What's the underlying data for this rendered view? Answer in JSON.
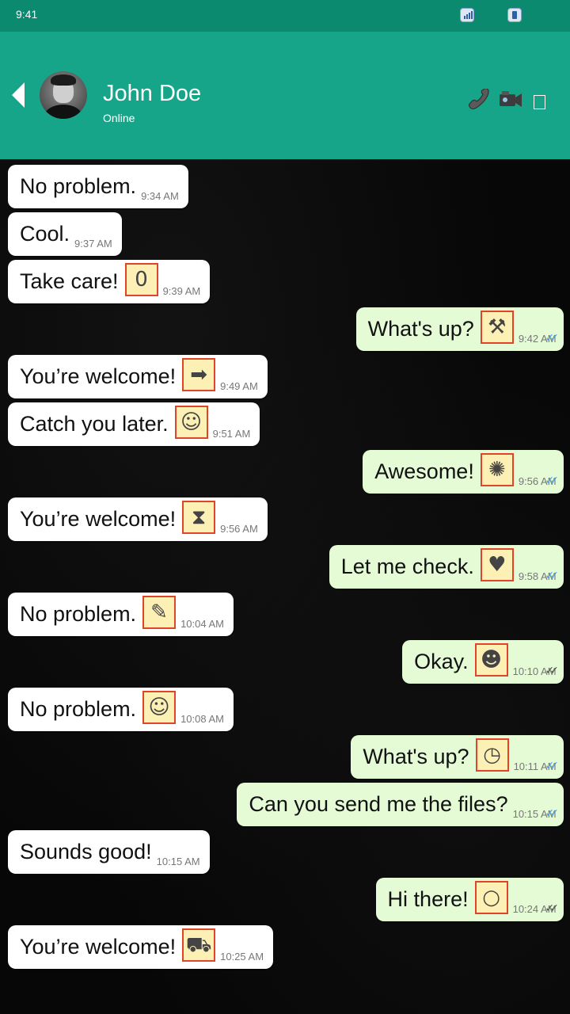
{
  "status_bar": {
    "time": "9:41"
  },
  "header": {
    "contact_name": "John Doe",
    "contact_status": "Online",
    "icons": [
      "back-arrow-icon",
      "phone-icon",
      "video-camera-icon",
      "menu-icon"
    ],
    "colors": {
      "header": "#17a58a",
      "status_bar": "#0b8a70"
    }
  },
  "messages": [
    {
      "dir": "in",
      "text": "No problem.",
      "emoji": "",
      "emoji_name": "",
      "time": "9:34 AM"
    },
    {
      "dir": "in",
      "text": "Cool.",
      "emoji": "",
      "emoji_name": "",
      "time": "9:37 AM"
    },
    {
      "dir": "in",
      "text": "Take care!",
      "emoji": "0",
      "emoji_name": "keycap-zero",
      "time": "9:39 AM"
    },
    {
      "dir": "out",
      "text": "What's up?",
      "emoji": "⚒",
      "emoji_name": "hammer-and-wrench",
      "time": "9:42 AM",
      "ticks": "read"
    },
    {
      "dir": "in",
      "text": "You’re welcome!",
      "emoji": "➡",
      "emoji_name": "person-with-cane-right",
      "time": "9:49 AM"
    },
    {
      "dir": "in",
      "text": "Catch you later.",
      "emoji": "☺",
      "emoji_name": "woman-guard",
      "time": "9:51 AM"
    },
    {
      "dir": "out",
      "text": "Awesome!",
      "emoji": "✺",
      "emoji_name": "hedgehog",
      "time": "9:56 AM",
      "ticks": "read"
    },
    {
      "dir": "in",
      "text": "You’re welcome!",
      "emoji": "⧗",
      "emoji_name": "thread-spool",
      "time": "9:56 AM"
    },
    {
      "dir": "out",
      "text": "Let me check.",
      "emoji": "♥",
      "emoji_name": "couple-with-heart",
      "time": "9:58 AM",
      "ticks": "read"
    },
    {
      "dir": "in",
      "text": "No problem.",
      "emoji": "✎",
      "emoji_name": "pen",
      "time": "10:04 AM"
    },
    {
      "dir": "out",
      "text": "Okay.",
      "emoji": "☻",
      "emoji_name": "woman-face",
      "time": "10:10 AM",
      "ticks": "sent"
    },
    {
      "dir": "in",
      "text": "No problem.",
      "emoji": "☺",
      "emoji_name": "person-wearing-turban",
      "time": "10:08 AM"
    },
    {
      "dir": "out",
      "text": "What's up?",
      "emoji": "◷",
      "emoji_name": "clock",
      "time": "10:11 AM",
      "ticks": "read"
    },
    {
      "dir": "out",
      "text": "Can you send me the files?",
      "emoji": "",
      "emoji_name": "",
      "time": "10:15 AM",
      "ticks": "read"
    },
    {
      "dir": "in",
      "text": "Sounds good!",
      "emoji": "",
      "emoji_name": "",
      "time": "10:15 AM"
    },
    {
      "dir": "out",
      "text": "Hi there!",
      "emoji": "○",
      "emoji_name": "white-circle",
      "time": "10:24 AM",
      "ticks": "sent"
    },
    {
      "dir": "in",
      "text": "You’re welcome!",
      "emoji": "⛟",
      "emoji_name": "car",
      "time": "10:25 AM"
    }
  ]
}
